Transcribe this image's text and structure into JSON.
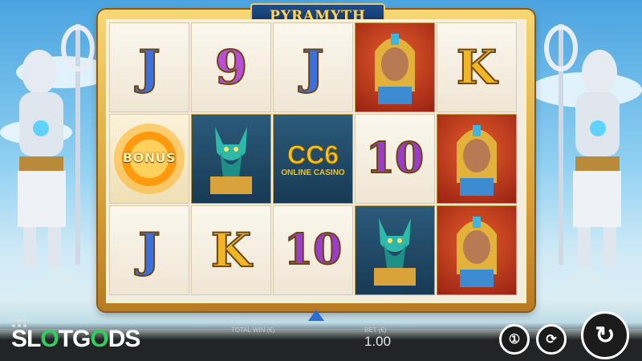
{
  "game": {
    "title": "PYRAMYTH",
    "reels": [
      [
        "J",
        "BONUS",
        "J"
      ],
      [
        "9",
        "ANUBIS",
        "K"
      ],
      [
        "J",
        "CC6",
        "10"
      ],
      [
        "QUEEN",
        "10",
        "ANUBIS"
      ],
      [
        "K",
        "QUEEN",
        "QUEEN"
      ]
    ]
  },
  "overlay": {
    "logo_main": "CC6",
    "logo_sub": "ONLINE CASINO"
  },
  "hud": {
    "brand_left": "SL",
    "brand_o": "O",
    "brand_mid": "TG",
    "brand_o2": "O",
    "brand_right": "DS",
    "total_win_label": "TOTAL WIN (€)",
    "bet_label": "BET (€)",
    "bet_value": "1.00",
    "autoplay_icon": "autoplay-icon",
    "coin_icon": "coin-icon",
    "spin_icon": "spin-icon"
  },
  "colors": {
    "frame_gold": "#d9a23a",
    "reel_blue": "#3f6fd9",
    "brand_green": "#2fcf5b"
  }
}
